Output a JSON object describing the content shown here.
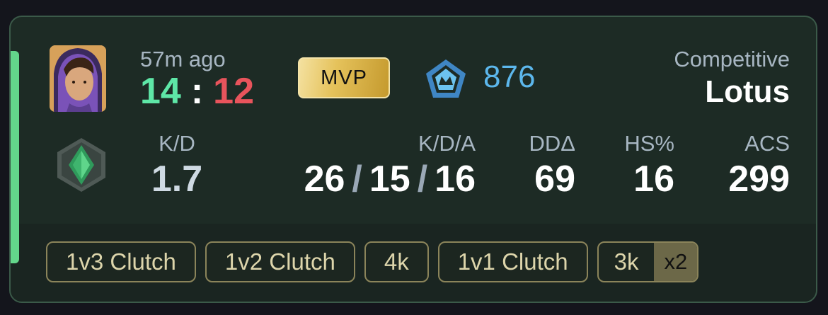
{
  "match": {
    "time_ago": "57m ago",
    "score_team": "14",
    "score_separator": ":",
    "score_enemy": "12",
    "badge_mvp": "MVP",
    "rr_value": "876",
    "rank_icon": "rank-emblem-icon",
    "mode": "Competitive",
    "map": "Lotus",
    "agent_icon": "agent-crystal-icon"
  },
  "stats": {
    "kd_label": "K/D",
    "kd_value": "1.7",
    "kda_label": "K/D/A",
    "kills": "26",
    "deaths": "15",
    "assists": "16",
    "slash": "/",
    "dd_label": "DDΔ",
    "dd_value": "69",
    "hs_label": "HS%",
    "hs_value": "16",
    "acs_label": "ACS",
    "acs_value": "299"
  },
  "highlights": [
    {
      "label": "1v3 Clutch"
    },
    {
      "label": "1v2 Clutch"
    },
    {
      "label": "4k"
    },
    {
      "label": "1v1 Clutch"
    },
    {
      "label": "3k",
      "multiplier": "x2"
    }
  ],
  "colors": {
    "win": "#5ee7a7",
    "loss": "#e8545c",
    "rr": "#5cb7ec",
    "accent": "#63d68b"
  }
}
